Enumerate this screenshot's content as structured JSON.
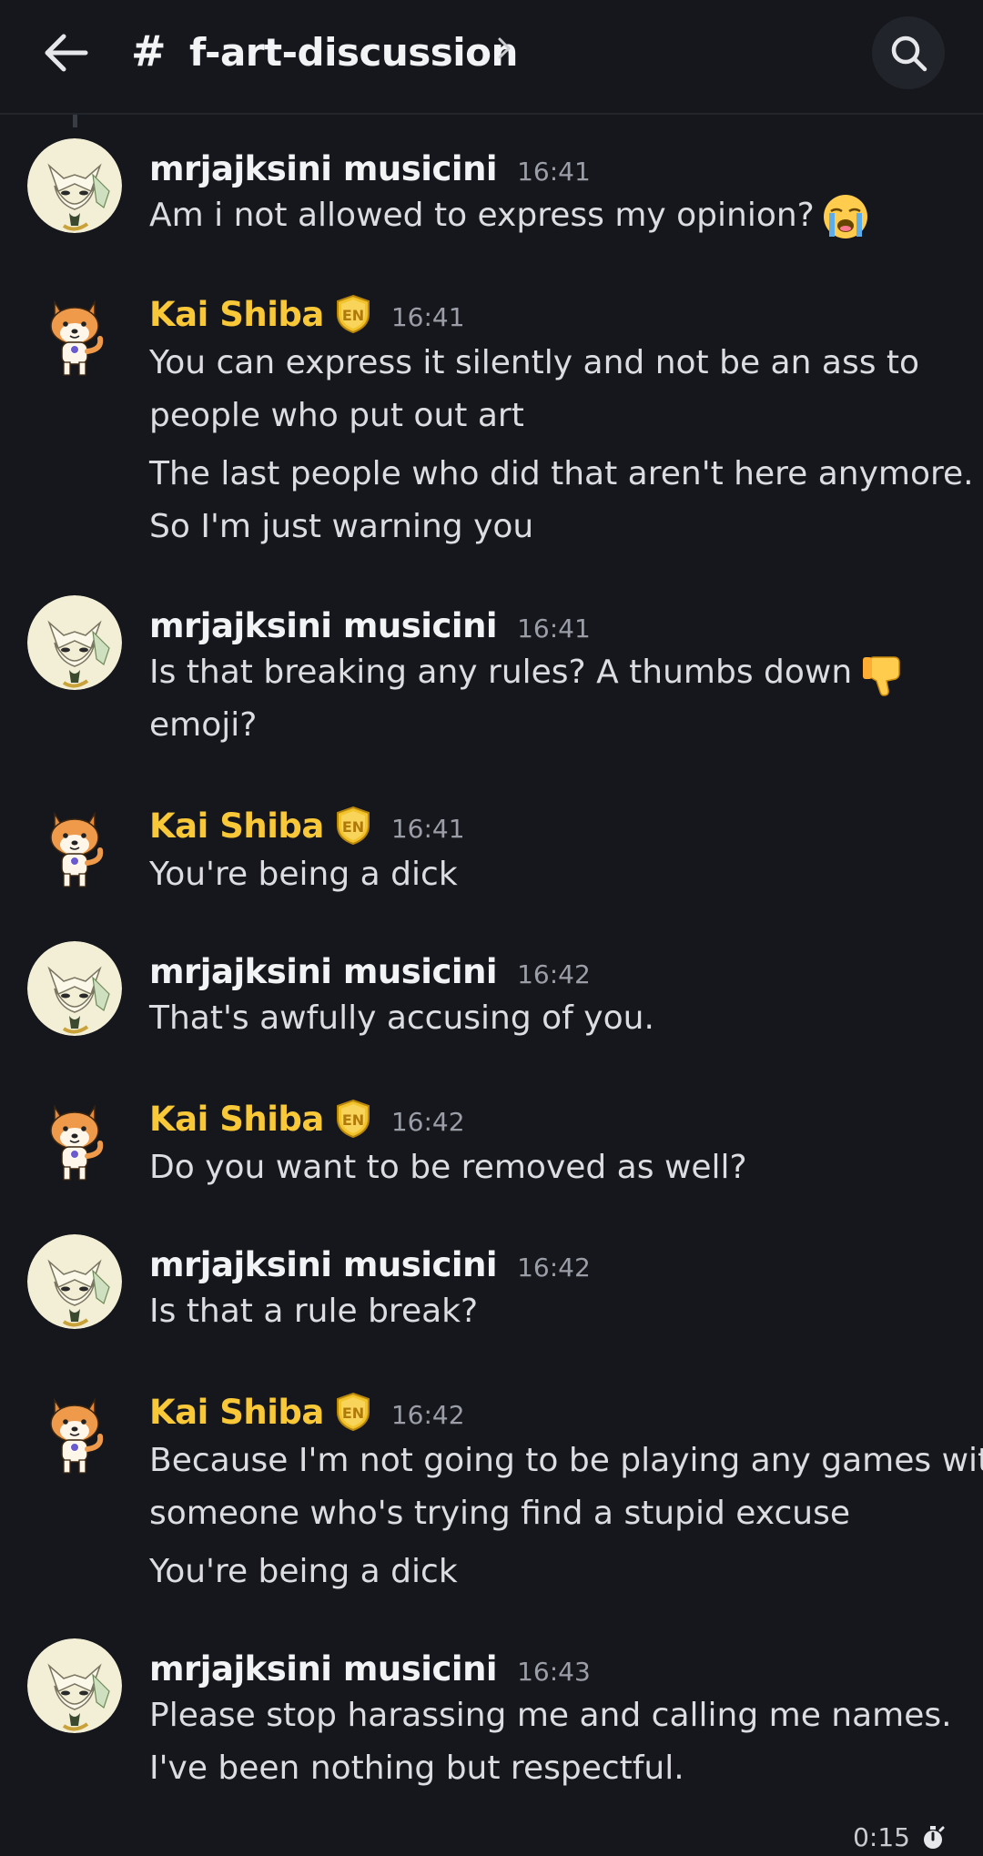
{
  "header": {
    "back_icon": "arrow-left-icon",
    "hash": "#",
    "channel_name": "f-art-discussion",
    "chevron_icon": "chevron-right-icon",
    "search_icon": "search-icon"
  },
  "messages": [
    {
      "author": "mrjajksini musicini",
      "author_style": "fox",
      "timestamp": "16:41",
      "lines": [
        "Am i not allowed to express my opinion?"
      ],
      "emoji": "loudly-crying-face"
    },
    {
      "author": "Kai Shiba",
      "author_style": "shiba",
      "badge": "EN",
      "timestamp": "16:41",
      "lines": [
        "You can express it silently and not be an ass to",
        "people who put out art",
        "The last people who did that aren't here anymore.",
        "So I'm just warning you"
      ]
    },
    {
      "author": "mrjajksini musicini",
      "author_style": "fox",
      "timestamp": "16:41",
      "lines": [
        "Is that breaking any rules? A thumbs down",
        "emoji?"
      ],
      "emoji": "thumbs-down"
    },
    {
      "author": "Kai Shiba",
      "author_style": "shiba",
      "badge": "EN",
      "timestamp": "16:41",
      "lines": [
        "You're being a dick"
      ]
    },
    {
      "author": "mrjajksini musicini",
      "author_style": "fox",
      "timestamp": "16:42",
      "lines": [
        "That's awfully accusing of you."
      ]
    },
    {
      "author": "Kai Shiba",
      "author_style": "shiba",
      "badge": "EN",
      "timestamp": "16:42",
      "lines": [
        "Do you want to be removed as well?"
      ]
    },
    {
      "author": "mrjajksini musicini",
      "author_style": "fox",
      "timestamp": "16:42",
      "lines": [
        "Is that a rule break?"
      ]
    },
    {
      "author": "Kai Shiba",
      "author_style": "shiba",
      "badge": "EN",
      "timestamp": "16:42",
      "lines": [
        "Because I'm not going to be playing any games with",
        "someone who's trying find a stupid excuse",
        "You're being a dick"
      ]
    },
    {
      "author": "mrjajksini musicini",
      "author_style": "fox",
      "timestamp": "16:43",
      "lines": [
        "Please stop harassing me and calling me names.",
        "I've been nothing but respectful."
      ]
    }
  ],
  "footer": {
    "timer": "0:15",
    "timer_icon": "stopwatch-icon"
  },
  "colors": {
    "background": "#16171d",
    "shiba_name": "#f8c838",
    "text": "#dcdde2",
    "timestamp": "#9b9ea6"
  }
}
